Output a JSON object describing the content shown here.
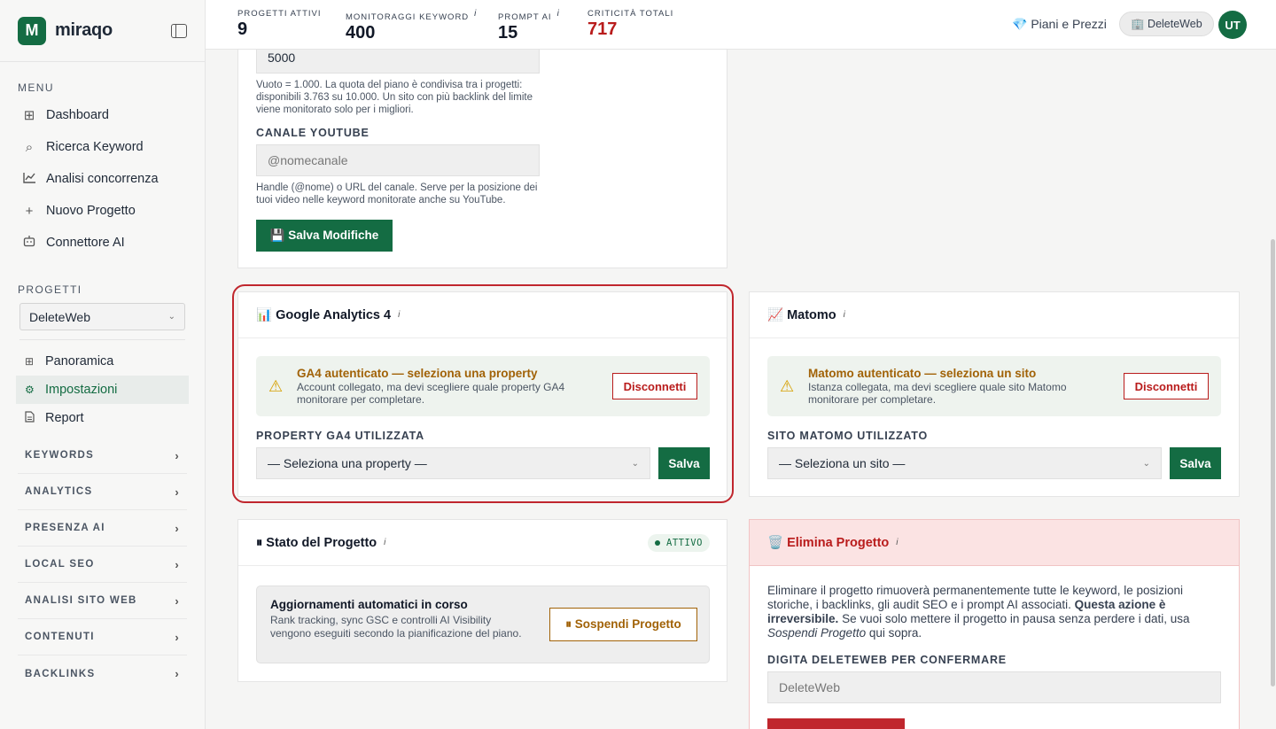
{
  "brand": {
    "logo_letter": "M",
    "name": "miraqo"
  },
  "sidebar": {
    "menu_label": "MENU",
    "menu_items": [
      {
        "label": "Dashboard",
        "icon": "grid-icon"
      },
      {
        "label": "Ricerca Keyword",
        "icon": "search-icon"
      },
      {
        "label": "Analisi concorrenza",
        "icon": "chart-line-icon"
      },
      {
        "label": "Nuovo Progetto",
        "icon": "plus-icon"
      },
      {
        "label": "Connettore AI",
        "icon": "robot-icon"
      }
    ],
    "projects_label": "PROGETTI",
    "project_selected": "DeleteWeb",
    "project_items": [
      {
        "label": "Panoramica",
        "icon": "grid-icon",
        "active": false
      },
      {
        "label": "Impostazioni",
        "icon": "gear-icon",
        "active": true
      },
      {
        "label": "Report",
        "icon": "document-icon",
        "active": false
      }
    ],
    "groups": [
      "KEYWORDS",
      "ANALYTICS",
      "PRESENZA AI",
      "LOCAL SEO",
      "ANALISI SITO WEB",
      "CONTENUTI",
      "BACKLINKS"
    ]
  },
  "topbar": {
    "stats": [
      {
        "label": "PROGETTI ATTIVI",
        "value": "9",
        "info": ""
      },
      {
        "label": "MONITORAGGI KEYWORD",
        "value": "400",
        "info": "i"
      },
      {
        "label": "PROMPT AI",
        "value": "15",
        "info": "i"
      },
      {
        "label": "CRITICITÀ TOTALI",
        "value": "717",
        "info": ""
      }
    ],
    "plans_label": "💎 Piani e Prezzi",
    "project_chip": "🏢 DeleteWeb",
    "avatar": "UT"
  },
  "settings_card": {
    "backlink_value": "5000",
    "backlink_hint": "Vuoto = 1.000. La quota del piano è condivisa tra i progetti: disponibili 3.763 su 10.000. Un sito con più backlink del limite viene monitorato solo per i migliori.",
    "youtube_label": "CANALE YOUTUBE",
    "youtube_placeholder": "@nomecanale",
    "youtube_hint": "Handle (@nome) o URL del canale. Serve per la posizione dei tuoi video nelle keyword monitorate anche su YouTube.",
    "save_label": "💾 Salva Modifiche"
  },
  "ga4": {
    "title": "📊 Google Analytics 4",
    "info": "i",
    "alert_title": "GA4 autenticato — seleziona una property",
    "alert_body": "Account collegato, ma devi scegliere quale property GA4 monitorare per completare.",
    "disconnect_label": "Disconnetti",
    "field_label": "PROPERTY GA4 UTILIZZATA",
    "select_value": "— Seleziona una property —",
    "save_label": "Salva"
  },
  "matomo": {
    "title": "📈 Matomo",
    "info": "i",
    "alert_title": "Matomo autenticato — seleziona un sito",
    "alert_body": "Istanza collegata, ma devi scegliere quale sito Matomo monitorare per completare.",
    "disconnect_label": "Disconnetti",
    "field_label": "SITO MATOMO UTILIZZATO",
    "select_value": "— Seleziona un sito —",
    "save_label": "Salva"
  },
  "status_card": {
    "title": "⏸ Stato del Progetto",
    "info": "i",
    "badge": "ATTIVO",
    "box_title": "Aggiornamenti automatici in corso",
    "box_body": "Rank tracking, sync GSC e controlli AI Visibility vengono eseguiti secondo la pianificazione del piano.",
    "suspend_label": "⏸ Sospendi Progetto"
  },
  "delete_card": {
    "title": "🗑️ Elimina Progetto",
    "info": "i",
    "body_1": "Eliminare il progetto rimuoverà permanentemente tutte le keyword, le posizioni storiche, i backlinks, gli audit SEO e i prompt AI associati. ",
    "body_bold": "Questa azione è irreversibile.",
    "body_2": " Se vuoi solo mettere il progetto in pausa senza perdere i dati, usa ",
    "body_italic": "Sospendi Progetto",
    "body_3": " qui sopra.",
    "confirm_label": "DIGITA DELETEWEB PER CONFERMARE",
    "confirm_placeholder": "DeleteWeb"
  },
  "colors": {
    "brand_green": "#146c43",
    "danger_red": "#b91c1c",
    "warning_amber": "#a16207"
  }
}
